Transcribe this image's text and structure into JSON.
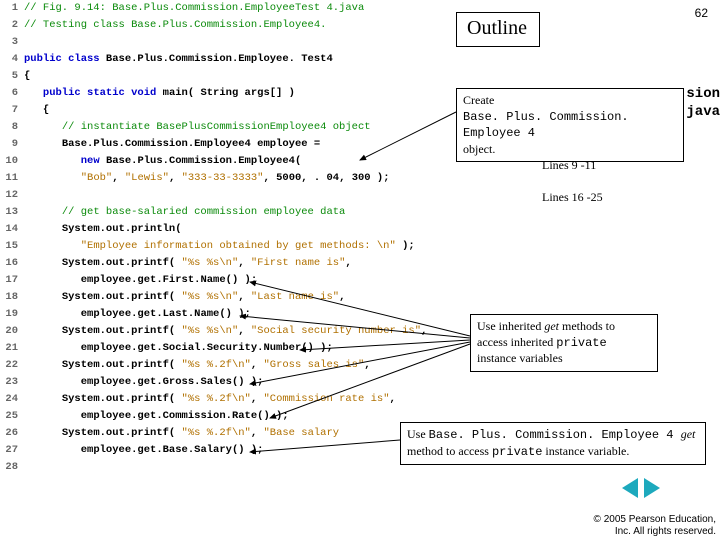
{
  "pageNumber": "62",
  "outlineLabel": "Outline",
  "partial1": "sion",
  "partial2": "java",
  "code": [
    {
      "n": "1",
      "spans": [
        {
          "c": "cmt",
          "t": "// Fig. 9.14: Base.Plus.Commission.EmployeeTest 4.java"
        }
      ]
    },
    {
      "n": "2",
      "spans": [
        {
          "c": "cmt",
          "t": "// Testing class Base.Plus.Commission.Employee4."
        }
      ]
    },
    {
      "n": "3",
      "spans": []
    },
    {
      "n": "4",
      "spans": [
        {
          "c": "kw",
          "t": "public class "
        },
        {
          "c": "id",
          "t": "Base.Plus.Commission.Employee. Test4"
        }
      ]
    },
    {
      "n": "5",
      "spans": [
        {
          "c": "id",
          "t": "{"
        }
      ]
    },
    {
      "n": "6",
      "spans": [
        {
          "c": "",
          "t": "   "
        },
        {
          "c": "kw",
          "t": "public static void "
        },
        {
          "c": "id",
          "t": "main( String args[] )"
        }
      ]
    },
    {
      "n": "7",
      "spans": [
        {
          "c": "",
          "t": "   "
        },
        {
          "c": "id",
          "t": "{"
        }
      ]
    },
    {
      "n": "8",
      "spans": [
        {
          "c": "",
          "t": "      "
        },
        {
          "c": "cmt",
          "t": "// instantiate BasePlusCommissionEmployee4 object"
        }
      ]
    },
    {
      "n": "9",
      "spans": [
        {
          "c": "",
          "t": "      "
        },
        {
          "c": "id",
          "t": "Base.Plus.Commission.Employee4 employee ="
        }
      ]
    },
    {
      "n": "10",
      "spans": [
        {
          "c": "",
          "t": "         "
        },
        {
          "c": "kw",
          "t": "new "
        },
        {
          "c": "id",
          "t": "Base.Plus.Commission.Employee4("
        }
      ]
    },
    {
      "n": "11",
      "spans": [
        {
          "c": "",
          "t": "         "
        },
        {
          "c": "str",
          "t": "\"Bob\""
        },
        {
          "c": "id",
          "t": ", "
        },
        {
          "c": "str",
          "t": "\"Lewis\""
        },
        {
          "c": "id",
          "t": ", "
        },
        {
          "c": "str",
          "t": "\"333-33-3333\""
        },
        {
          "c": "id",
          "t": ", 5000, . 04, 300 );"
        }
      ]
    },
    {
      "n": "12",
      "spans": []
    },
    {
      "n": "13",
      "spans": [
        {
          "c": "",
          "t": "      "
        },
        {
          "c": "cmt",
          "t": "// get base-salaried commission employee data"
        }
      ]
    },
    {
      "n": "14",
      "spans": [
        {
          "c": "",
          "t": "      "
        },
        {
          "c": "id",
          "t": "System.out.println("
        }
      ]
    },
    {
      "n": "15",
      "spans": [
        {
          "c": "",
          "t": "         "
        },
        {
          "c": "str",
          "t": "\"Employee information obtained by get methods: \\n\""
        },
        {
          "c": "id",
          "t": " );"
        }
      ]
    },
    {
      "n": "16",
      "spans": [
        {
          "c": "",
          "t": "      "
        },
        {
          "c": "id",
          "t": "System.out.printf( "
        },
        {
          "c": "str",
          "t": "\"%s %s\\n\""
        },
        {
          "c": "id",
          "t": ", "
        },
        {
          "c": "str",
          "t": "\"First name is\""
        },
        {
          "c": "id",
          "t": ","
        }
      ]
    },
    {
      "n": "17",
      "spans": [
        {
          "c": "",
          "t": "         "
        },
        {
          "c": "id",
          "t": "employee.get.First.Name() );"
        }
      ]
    },
    {
      "n": "18",
      "spans": [
        {
          "c": "",
          "t": "      "
        },
        {
          "c": "id",
          "t": "System.out.printf( "
        },
        {
          "c": "str",
          "t": "\"%s %s\\n\""
        },
        {
          "c": "id",
          "t": ", "
        },
        {
          "c": "str",
          "t": "\"Last name is\""
        },
        {
          "c": "id",
          "t": ","
        }
      ]
    },
    {
      "n": "19",
      "spans": [
        {
          "c": "",
          "t": "         "
        },
        {
          "c": "id",
          "t": "employee.get.Last.Name() );"
        }
      ]
    },
    {
      "n": "20",
      "spans": [
        {
          "c": "",
          "t": "      "
        },
        {
          "c": "id",
          "t": "System.out.printf( "
        },
        {
          "c": "str",
          "t": "\"%s %s\\n\""
        },
        {
          "c": "id",
          "t": ", "
        },
        {
          "c": "str",
          "t": "\"Social security number is\""
        },
        {
          "c": "id",
          "t": ","
        }
      ]
    },
    {
      "n": "21",
      "spans": [
        {
          "c": "",
          "t": "         "
        },
        {
          "c": "id",
          "t": "employee.get.Social.Security.Number() );"
        }
      ]
    },
    {
      "n": "22",
      "spans": [
        {
          "c": "",
          "t": "      "
        },
        {
          "c": "id",
          "t": "System.out.printf( "
        },
        {
          "c": "str",
          "t": "\"%s %.2f\\n\""
        },
        {
          "c": "id",
          "t": ", "
        },
        {
          "c": "str",
          "t": "\"Gross sales is\""
        },
        {
          "c": "id",
          "t": ","
        }
      ]
    },
    {
      "n": "23",
      "spans": [
        {
          "c": "",
          "t": "         "
        },
        {
          "c": "id",
          "t": "employee.get.Gross.Sales() );"
        }
      ]
    },
    {
      "n": "24",
      "spans": [
        {
          "c": "",
          "t": "      "
        },
        {
          "c": "id",
          "t": "System.out.printf( "
        },
        {
          "c": "str",
          "t": "\"%s %.2f\\n\""
        },
        {
          "c": "id",
          "t": ", "
        },
        {
          "c": "str",
          "t": "\"Commission rate is\""
        },
        {
          "c": "id",
          "t": ","
        }
      ]
    },
    {
      "n": "25",
      "spans": [
        {
          "c": "",
          "t": "         "
        },
        {
          "c": "id",
          "t": "employee.get.Commission.Rate() );"
        }
      ]
    },
    {
      "n": "26",
      "spans": [
        {
          "c": "",
          "t": "      "
        },
        {
          "c": "id",
          "t": "System.out.printf( "
        },
        {
          "c": "str",
          "t": "\"%s %.2f\\n\""
        },
        {
          "c": "id",
          "t": ", "
        },
        {
          "c": "str",
          "t": "\"Base salary"
        }
      ]
    },
    {
      "n": "27",
      "spans": [
        {
          "c": "",
          "t": "         "
        },
        {
          "c": "id",
          "t": "employee.get.Base.Salary() );"
        }
      ]
    },
    {
      "n": "28",
      "spans": []
    }
  ],
  "callout1": {
    "pre": "Create",
    "obj": "Base. Plus. Commission. Employee 4",
    "post": "object."
  },
  "linesNote1": "Lines 9 -11",
  "linesNote2": "Lines 16 -25",
  "callout2": {
    "l1a": "Use inherited ",
    "l1b": "get",
    "l1c": " methods to",
    "l2a": "access inherited ",
    "l2b": "private",
    "l3": "instance variables"
  },
  "callout3": {
    "l1a": "Use ",
    "l1b": "Base. Plus. Commission. Employee 4 ",
    "l1c": "get",
    "l2a": "method to access ",
    "l2b": "private",
    "l2c": " instance variable."
  },
  "copyright1": "© 2005 Pearson Education,",
  "copyright2": "Inc. All rights reserved."
}
